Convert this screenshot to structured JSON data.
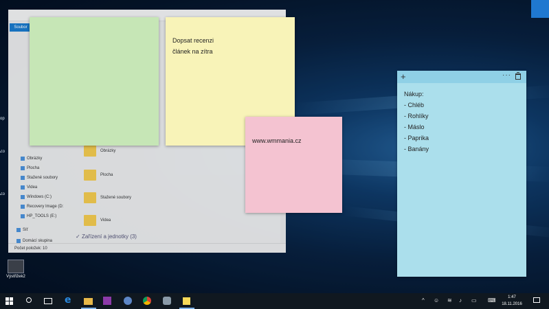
{
  "explorer": {
    "ribbon_tab": "Soubor",
    "sidebar_items": [
      "Obrázky",
      "Plocha",
      "Stažené soubory",
      "Videa",
      "Windows (C:)",
      "Recovery Image (D:",
      "HP_TOOLS (E:)",
      "Síť",
      "Domácí skupina"
    ],
    "folders": [
      "Obrázky",
      "Plocha",
      "Stažené soubory",
      "Videa"
    ],
    "section_header": "Zařízení a jednotky (3)",
    "status": "Počet položek: 10"
  },
  "desktop": {
    "icon_label": "Výstřižek2"
  },
  "notes": {
    "yellow": "Dopsat recenzi\nčlánek na zítra",
    "pink": "www.wmmania.cz",
    "blue": "Nákup:\n- Chléb\n- Rohlíky\n- Máslo\n- Paprika\n- Banány",
    "colors": {
      "green": "#c6e6b6",
      "yellow": "#f8f3b8",
      "pink": "#f4c3d1",
      "blue": "#abdfec"
    }
  },
  "taskbar": {
    "time": "1:47",
    "date": "18.11.2016"
  }
}
